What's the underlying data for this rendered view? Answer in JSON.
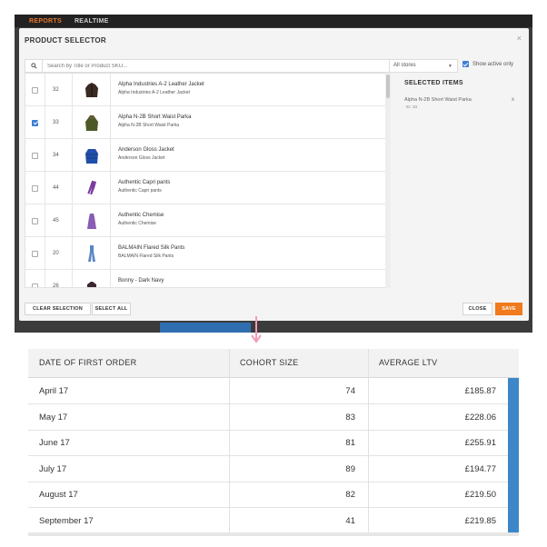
{
  "app_nav": {
    "reports": "REPORTS",
    "realtime": "REALTIME"
  },
  "modal": {
    "title": "PRODUCT SELECTOR",
    "close_glyph": "×",
    "search_placeholder": "Search by Title or Product SKU...",
    "store_select_value": "All stores",
    "show_active_label": "Show active only",
    "show_active_checked": true
  },
  "products": [
    {
      "id": "32",
      "title": "Alpha Industries A-2 Leather Jacket",
      "subtitle": "Alpha Industries A-2 Leather Jacket",
      "checked": false,
      "thumb": "leather-jacket",
      "color": "#3a2a22"
    },
    {
      "id": "33",
      "title": "Alpha N-2B Short Waist Parka",
      "subtitle": "Alpha N-2B Short Waist Parka",
      "checked": true,
      "thumb": "parka",
      "color": "#4d5a28"
    },
    {
      "id": "34",
      "title": "Anderson Gloss Jacket",
      "subtitle": "Anderson Gloss Jacket",
      "checked": false,
      "thumb": "puffer-jacket",
      "color": "#1f4fa8"
    },
    {
      "id": "44",
      "title": "Authentic Capri pants",
      "subtitle": "Authentic Capri pants",
      "checked": false,
      "thumb": "capri-pants",
      "color": "#7a3d9e"
    },
    {
      "id": "45",
      "title": "Authentic Chemise",
      "subtitle": "Authentic Chemise",
      "checked": false,
      "thumb": "chemise",
      "color": "#8a5cb3"
    },
    {
      "id": "20",
      "title": "BALMAIN Flared Silk Pants",
      "subtitle": "BALMAIN Flared Silk Pants",
      "checked": false,
      "thumb": "flared-pants",
      "color": "#5a86c4"
    },
    {
      "id": "26",
      "title": "Bonny - Dark Navy",
      "subtitle": "",
      "checked": false,
      "thumb": "dark-top",
      "color": "#3a2530"
    }
  ],
  "selected_panel": {
    "title": "SELECTED ITEMS",
    "item_name": "Alpha N-2B Short Waist Parka",
    "item_id": "ID: 33",
    "remove_glyph": "x"
  },
  "buttons": {
    "clear_selection": "CLEAR SELECTION",
    "select_all": "SELECT ALL",
    "close": "CLOSE",
    "save": "SAVE"
  },
  "colors": {
    "accent_orange": "#f07a1d",
    "accent_blue": "#3b7fd4",
    "arrow_pink": "#f29bbd"
  },
  "cohort_table": {
    "headers": [
      "DATE OF FIRST ORDER",
      "COHORT SIZE",
      "AVERAGE LTV"
    ],
    "rows": [
      {
        "date": "April 17",
        "size": "74",
        "ltv": "£185.87"
      },
      {
        "date": "May 17",
        "size": "83",
        "ltv": "£228.06"
      },
      {
        "date": "June 17",
        "size": "81",
        "ltv": "£255.91"
      },
      {
        "date": "July 17",
        "size": "89",
        "ltv": "£194.77"
      },
      {
        "date": "August 17",
        "size": "82",
        "ltv": "£219.50"
      },
      {
        "date": "September 17",
        "size": "41",
        "ltv": "£219.85"
      }
    ]
  }
}
